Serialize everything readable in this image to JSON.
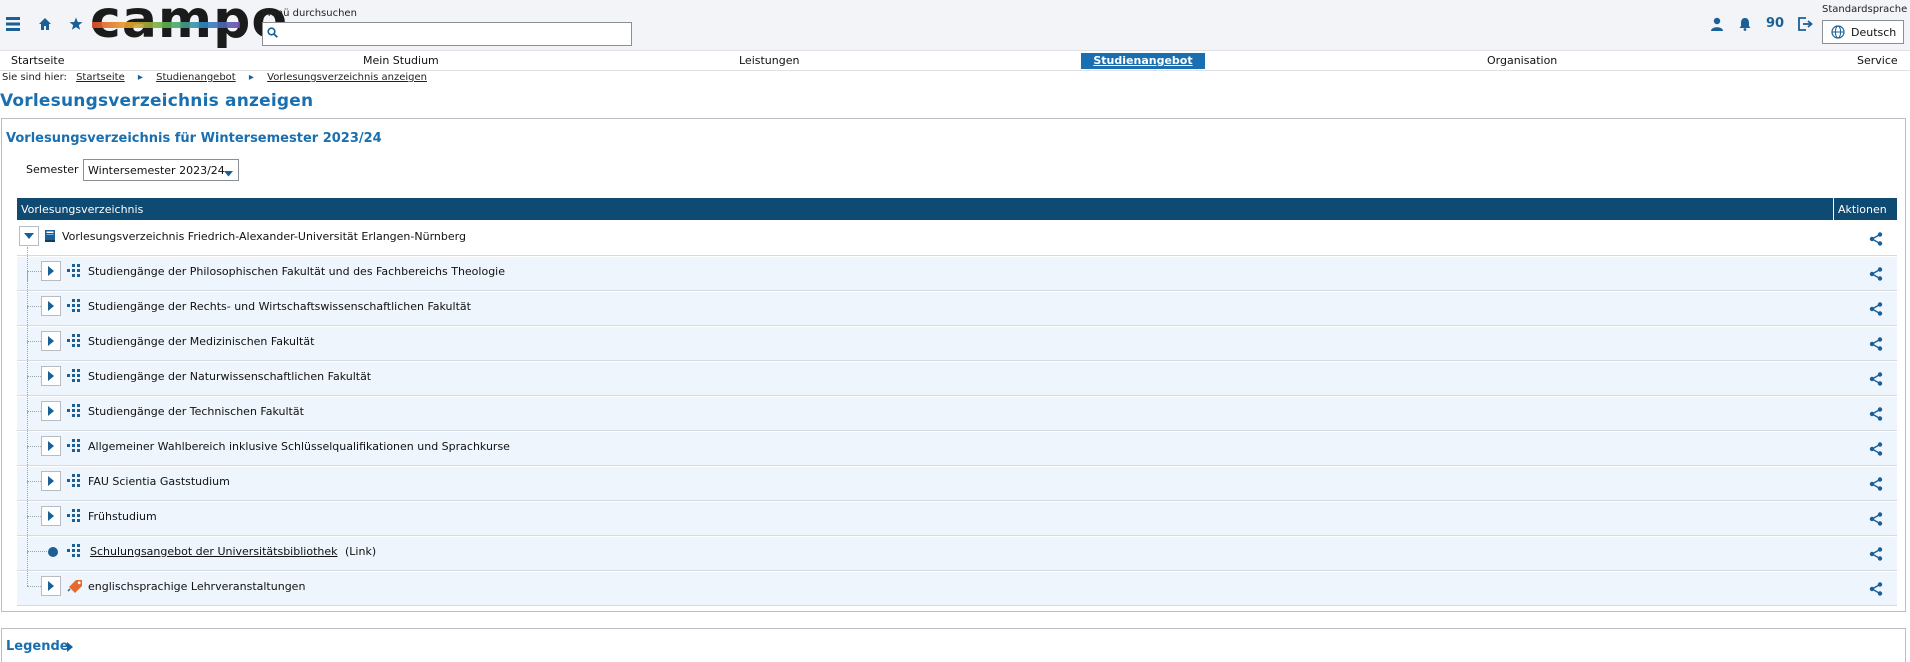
{
  "header": {
    "logo_text": "campo",
    "search_label": "Menü durchsuchen",
    "search_placeholder": "",
    "notification_count": "90",
    "language_label": "Standardsprache",
    "language_value": "Deutsch"
  },
  "nav": {
    "items": [
      {
        "label": "Startseite"
      },
      {
        "label": "Mein Studium"
      },
      {
        "label": "Leistungen"
      },
      {
        "label": "Studienangebot"
      },
      {
        "label": "Organisation"
      },
      {
        "label": "Service"
      }
    ],
    "active": "Studienangebot"
  },
  "breadcrumb": {
    "prefix": "Sie sind hier:",
    "items": [
      "Startseite",
      "Studienangebot",
      "Vorlesungsverzeichnis anzeigen"
    ]
  },
  "page_title": "Vorlesungsverzeichnis anzeigen",
  "panel": {
    "title": "Vorlesungsverzeichnis für Wintersemester 2023/24",
    "semester_label": "Semester",
    "semester_value": "Wintersemester 2023/24",
    "col_name": "Vorlesungsverzeichnis",
    "col_actions": "Aktionen"
  },
  "tree": {
    "root": {
      "label": "Vorlesungsverzeichnis Friedrich-Alexander-Universität Erlangen-Nürnberg",
      "icon": "book-icon"
    },
    "children": [
      {
        "label": "Studiengänge der Philosophischen Fakultät und des Fachbereichs Theologie",
        "icon": "structure-icon"
      },
      {
        "label": "Studiengänge der Rechts- und Wirtschaftswissenschaftlichen Fakultät",
        "icon": "structure-icon"
      },
      {
        "label": "Studiengänge der Medizinischen Fakultät",
        "icon": "structure-icon"
      },
      {
        "label": "Studiengänge der Naturwissenschaftlichen Fakultät",
        "icon": "structure-icon"
      },
      {
        "label": "Studiengänge der Technischen Fakultät",
        "icon": "structure-icon"
      },
      {
        "label": "Allgemeiner Wahlbereich inklusive Schlüsselqualifikationen und Sprachkurse",
        "icon": "structure-icon"
      },
      {
        "label": "FAU Scientia Gaststudium",
        "icon": "structure-icon"
      },
      {
        "label": "Frühstudium",
        "icon": "structure-icon"
      },
      {
        "label": "Schulungsangebot der Universitätsbibliothek",
        "suffix": "(Link)",
        "icon": "structure-icon"
      },
      {
        "label": "englischsprachige Lehrveranstaltungen",
        "icon": "tag-icon"
      }
    ]
  },
  "legend": {
    "label": "Legende"
  },
  "colors": {
    "primary": "#1a6fb0",
    "header_bar": "#0f4a73",
    "row_alt": "#eef5fc"
  }
}
